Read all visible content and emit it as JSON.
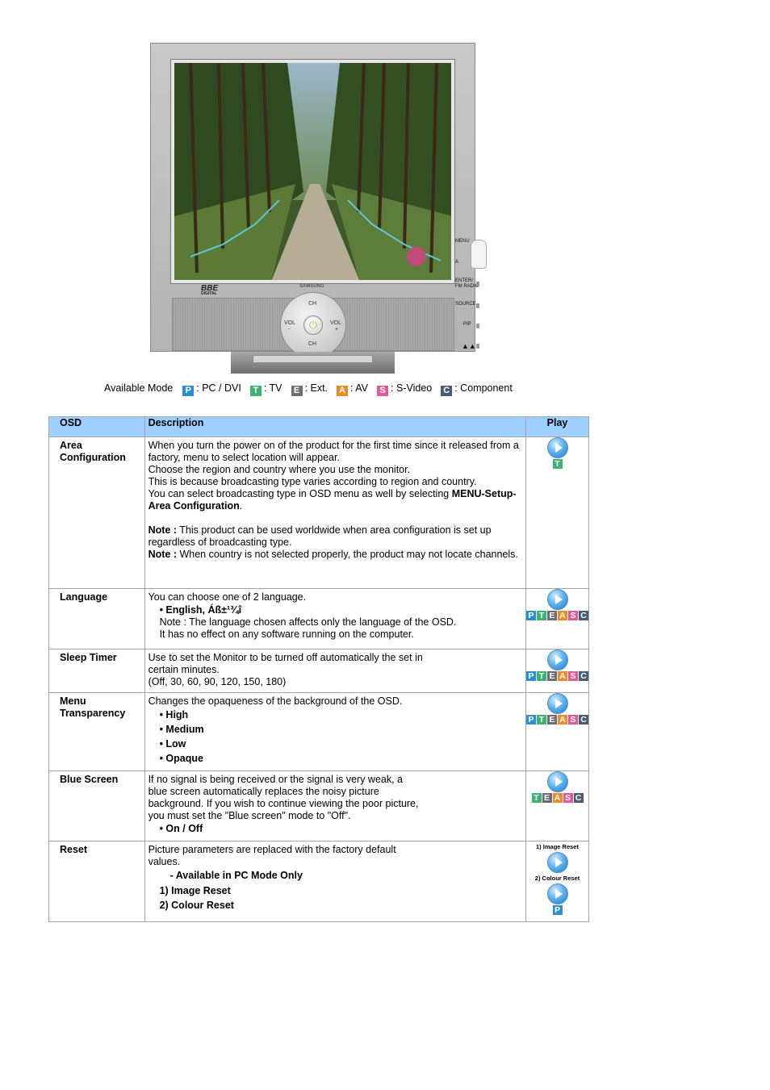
{
  "monitor": {
    "brand": "SAMSUNG",
    "bbe_label": "BBE",
    "bbe_sub": "DIGITAL",
    "dial": {
      "ch_top": "CH",
      "ch_bottom": "CH",
      "vol_left": "VOL",
      "vol_right": "VOL",
      "minus": "-",
      "plus": "+"
    },
    "side_buttons": [
      "MENU",
      "A",
      "ENTER/",
      "FM RADIO",
      "SOURCE",
      "PIP"
    ]
  },
  "modes": {
    "label": "Available Mode",
    "items": [
      {
        "chip": "P",
        "text": ": PC / DVI",
        "color": "#2e8fd0"
      },
      {
        "chip": "T",
        "text": ": TV",
        "color": "#3cb371"
      },
      {
        "chip": "E",
        "text": ": Ext.",
        "color": "#6d6d7a"
      },
      {
        "chip": "A",
        "text": ": AV",
        "color": "#f08a24"
      },
      {
        "chip": "S",
        "text": ": S-Video",
        "color": "#e05a9a"
      },
      {
        "chip": "C",
        "text": ": Component",
        "color": "#4a5b78"
      }
    ]
  },
  "table": {
    "headers": {
      "osd": "OSD",
      "description": "Description",
      "play": "Play"
    },
    "header_color": "#9dcfff",
    "chip_colors": {
      "P": "#2e8fd0",
      "T": "#3cb371",
      "E": "#6d6d7a",
      "A": "#f08a24",
      "S": "#e05a9a",
      "C": "#4a5b78"
    },
    "rows": {
      "area": {
        "name": "Area Configuration",
        "l1": "When you turn the power on of the product for the first time since it released from a factory, menu to select location will appear.",
        "l2": "Choose the region and country where you use the monitor.",
        "l3": "This is because broadcasting type varies according to region and country.",
        "l4": "You can select broadcasting type in OSD menu as well by selecting ",
        "l4_bold": "MENU-Setup-Area Configuration",
        "l4_end": ".",
        "note_label": "Note :",
        "note1": " This product can be used worldwide when area configuration is set up regardless of broadcasting type.",
        "note2": " When country is not selected properly, the product may not locate channels.",
        "chips": [
          "T"
        ]
      },
      "language": {
        "name": "Language",
        "l1": "You can choose one of 2 language.",
        "bullet": "• English, Áß±¹¾î",
        "note1": "Note : The language chosen affects only the language of the OSD.",
        "note2": "It has no effect on any software running on the computer.",
        "chips": [
          "P",
          "T",
          "E",
          "A",
          "S",
          "C"
        ]
      },
      "sleep": {
        "name": "Sleep Timer",
        "l1": "Use to set the Monitor to be turned off automatically the set in",
        "l2": "certain minutes.",
        "l3": "(Off, 30, 60, 90, 120, 150, 180)",
        "chips": [
          "P",
          "T",
          "E",
          "A",
          "S",
          "C"
        ]
      },
      "transparency": {
        "name": "Menu Transparency",
        "l1": "Changes the opaqueness of the background of the OSD.",
        "b1": "• High",
        "b2": "• Medium",
        "b3": "• Low",
        "b4": "• Opaque",
        "chips": [
          "P",
          "T",
          "E",
          "A",
          "S",
          "C"
        ]
      },
      "blue": {
        "name": "Blue Screen",
        "l1": "If no signal is being received or the signal is very weak, a",
        "l2": "blue screen automatically replaces the noisy picture",
        "l3": "background. If you wish to continue viewing the poor picture,",
        "l4": "you must set the \"Blue screen\" mode to \"Off\".",
        "b1": "• On / Off",
        "chips": [
          "T",
          "E",
          "A",
          "S",
          "C"
        ]
      },
      "reset": {
        "name": "Reset",
        "l1": "Picture parameters are replaced with the factory default",
        "l2": "values.",
        "l3": "- Available in PC Mode Only",
        "b1": "1) Image Reset",
        "b2": "2) Colour Reset",
        "play_lbl1": "1) Image Reset",
        "play_lbl2": "2) Colour Reset",
        "chips": [
          "P"
        ]
      }
    }
  }
}
